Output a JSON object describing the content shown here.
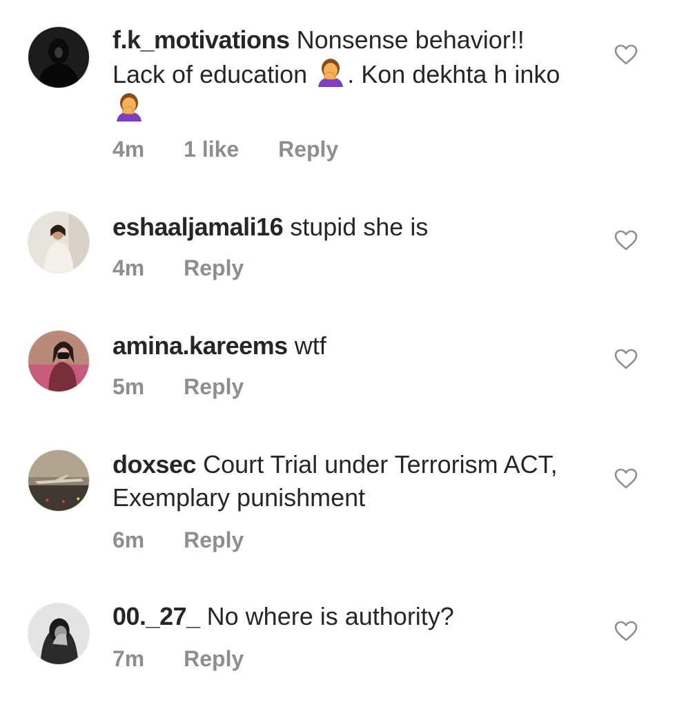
{
  "comments": [
    {
      "username": "f.k_motivations",
      "text_part1": "Nonsense behavior!! Lack of education ",
      "text_part2": ". Kon dekhta h inko",
      "time": "4m",
      "likes": "1 like",
      "reply": "Reply",
      "avatar_icon": "person-silhouette-dark"
    },
    {
      "username": "eshaaljamali16",
      "text": "stupid she is",
      "time": "4m",
      "reply": "Reply",
      "avatar_icon": "person-white-outfit"
    },
    {
      "username": "amina.kareems",
      "text": "wtf",
      "time": "5m",
      "reply": "Reply",
      "avatar_icon": "person-black-mask"
    },
    {
      "username": "doxsec",
      "text": "Court Trial under Terrorism ACT, Exemplary punishment",
      "time": "6m",
      "reply": "Reply",
      "avatar_icon": "airplane-runway"
    },
    {
      "username": "00._27_",
      "text": "No where is authority?",
      "time": "7m",
      "reply": "Reply",
      "avatar_icon": "person-hand-face"
    }
  ],
  "emoji_name": "woman-facepalming-emoji",
  "colors": {
    "text": "#262626",
    "meta": "#8e8e8e",
    "emoji_shirt": "#7b3fbf",
    "emoji_skin": "#f6b15a"
  }
}
